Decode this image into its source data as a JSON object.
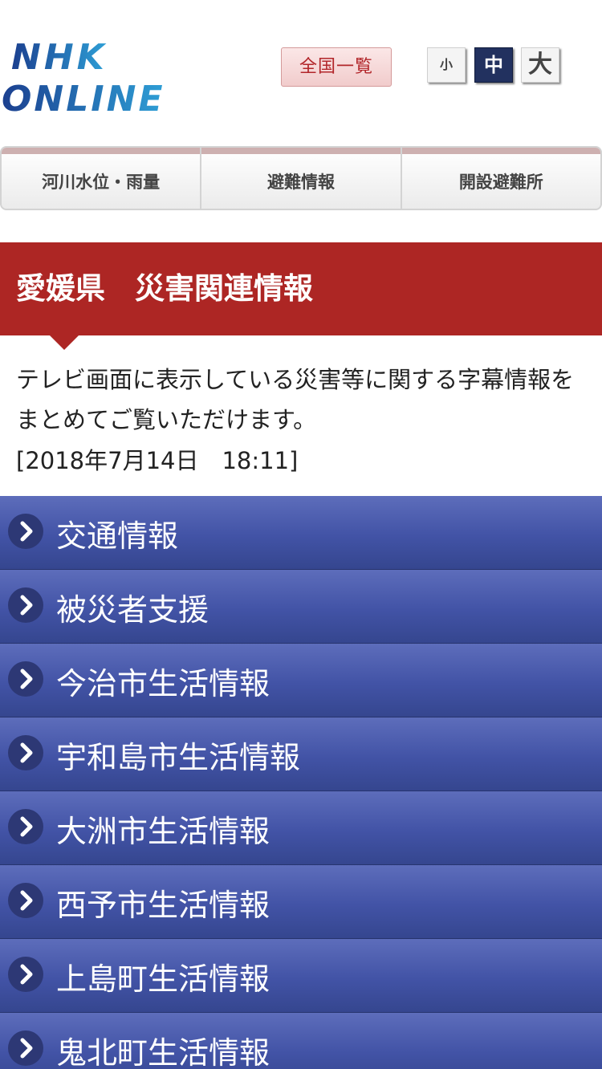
{
  "header": {
    "logo_text": [
      "NHK",
      "ONLINE"
    ],
    "all_list_label": "全国一覧",
    "font_sizes": {
      "small": "小",
      "medium": "中",
      "large": "大",
      "selected": "medium"
    }
  },
  "tabs": [
    {
      "label": "河川水位・雨量"
    },
    {
      "label": "避難情報"
    },
    {
      "label": "開設避難所"
    }
  ],
  "page": {
    "title": "愛媛県　災害関連情報",
    "intro": "テレビ画面に表示している災害等に関する字幕情報をまとめてご覧いただけます。",
    "timestamp": "[2018年7月14日　18:11]"
  },
  "menu": [
    {
      "label": "交通情報"
    },
    {
      "label": "被災者支援"
    },
    {
      "label": "今治市生活情報"
    },
    {
      "label": "宇和島市生活情報"
    },
    {
      "label": "大洲市生活情報"
    },
    {
      "label": "西予市生活情報"
    },
    {
      "label": "上島町生活情報"
    },
    {
      "label": "鬼北町生活情報"
    }
  ],
  "icons": {
    "menu_chevron": "chevron-right-icon"
  },
  "colors": {
    "title_bar": "#ad2624",
    "menu_blue": "#4253a6",
    "logo_blue": "#1f4e9c",
    "logo_cyan": "#2fa6d9"
  }
}
